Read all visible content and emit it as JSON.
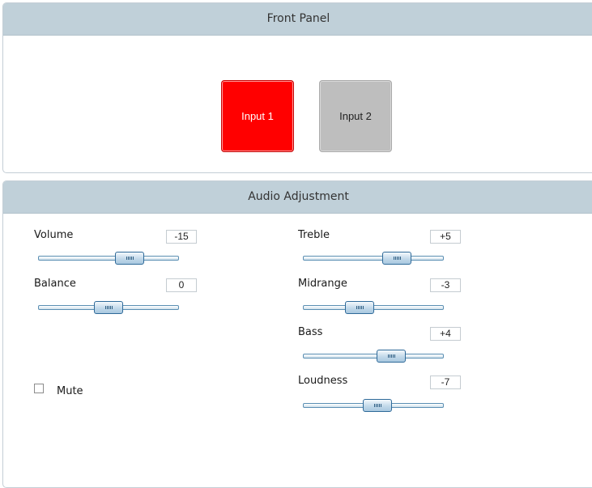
{
  "front_panel": {
    "title": "Front Panel",
    "inputs": [
      {
        "label": "Input 1",
        "active": true,
        "color": "#ff0000"
      },
      {
        "label": "Input 2",
        "active": false,
        "color": "#bebebe"
      }
    ]
  },
  "audio": {
    "title": "Audio Adjustment",
    "sliders": [
      {
        "label": "Volume",
        "value": "-15",
        "level": 0.65
      },
      {
        "label": "Balance",
        "value": "0",
        "level": 0.5
      },
      {
        "label": "Treble",
        "value": "+5",
        "level": 0.67
      },
      {
        "label": "Midrange",
        "value": "-3",
        "level": 0.4
      },
      {
        "label": "Bass",
        "value": "+4",
        "level": 0.63
      },
      {
        "label": "Loudness",
        "value": "-7",
        "level": 0.53
      }
    ],
    "mute": {
      "label": "Mute",
      "checked": false
    }
  },
  "colors": {
    "header": "#c0d0d9",
    "accent": "#ff0000",
    "track_border": "#5b8fb3"
  }
}
